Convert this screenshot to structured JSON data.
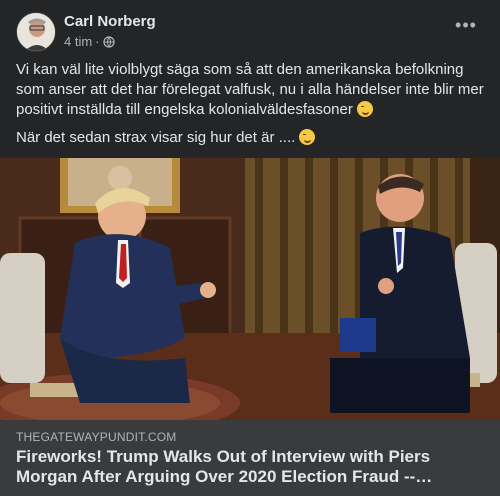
{
  "post": {
    "author": "Carl Norberg",
    "time": "4 tim",
    "separator": "·",
    "privacy_icon": "globe-icon",
    "more_icon": "more-options-icon",
    "more_label": "•••",
    "paragraph1": "Vi kan väl lite violblygt säga som så att den amerikanska befolkning som anser att det har förelegat valfusk, nu i alla händelser inte blir mer positivt inställda till engelska kolonialväldesfasoner",
    "paragraph2": "När det sedan strax visar sig hur det är ....",
    "emoji": "smirking-face-emoji"
  },
  "link": {
    "domain": "THEGATEWAYPUNDIT.COM",
    "title": "Fireworks! Trump Walks Out of Interview with Piers Morgan After Arguing Over 2020 Election Fraud --…"
  },
  "colors": {
    "card_bg": "#242526",
    "footer_bg": "#3a3b3c",
    "primary_text": "#e4e6eb",
    "secondary_text": "#b0b3b8"
  }
}
